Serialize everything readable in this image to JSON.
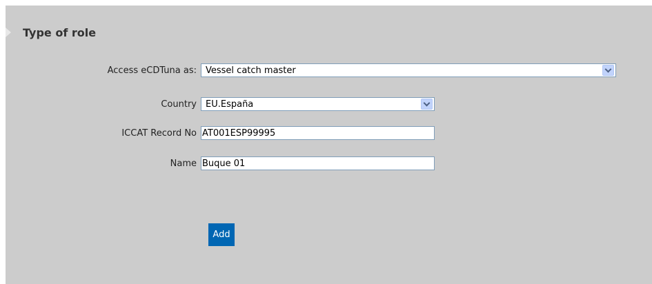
{
  "section": {
    "title": "Type of role"
  },
  "form": {
    "access": {
      "label": "Access eCDTuna as:",
      "value": "Vessel catch master"
    },
    "country": {
      "label": "Country",
      "value": "EU.España"
    },
    "iccat": {
      "label": "ICCAT Record No",
      "value": "AT001ESP99995"
    },
    "name": {
      "label": "Name",
      "value": "Buque 01"
    }
  },
  "actions": {
    "add_label": "Add"
  },
  "colors": {
    "panel_background": "#cccccc",
    "add_button": "#0066b3"
  },
  "icons": [
    "arrow-right-icon",
    "chevron-down-icon"
  ]
}
